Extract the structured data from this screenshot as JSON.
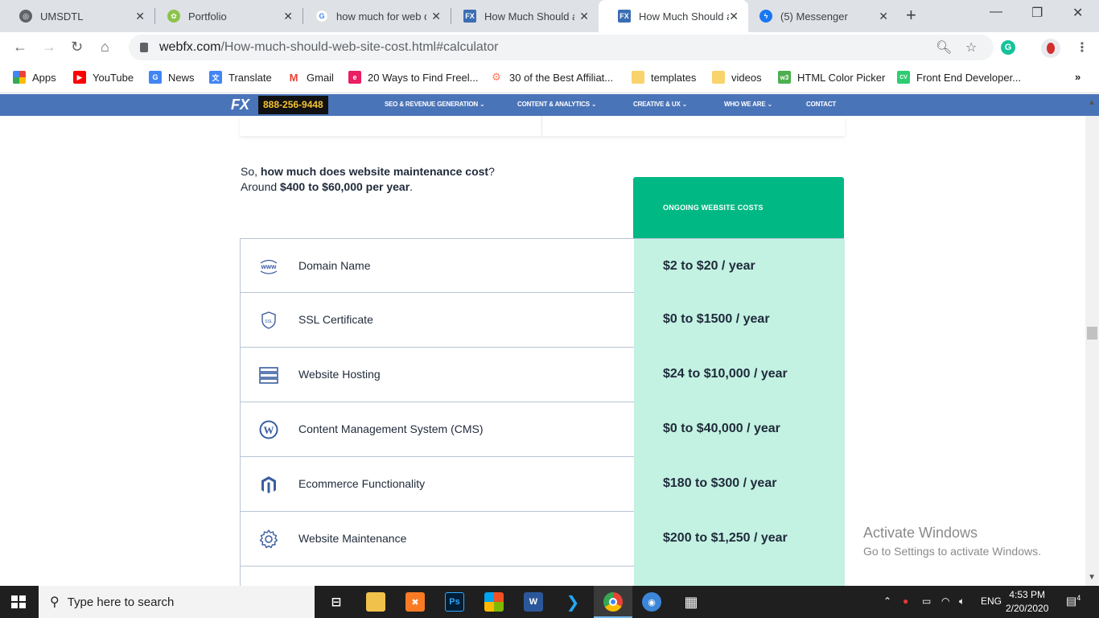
{
  "browser": {
    "tabs": [
      {
        "title": "UMSDTL",
        "icon": "globe-icon"
      },
      {
        "title": "Portfolio",
        "icon": "portfolio-icon"
      },
      {
        "title": "how much for web d",
        "icon": "google-icon"
      },
      {
        "title": "How Much Should a",
        "icon": "webfx-icon"
      },
      {
        "title": "How Much Should a",
        "icon": "webfx-icon",
        "active": true
      },
      {
        "title": "(5) Messenger",
        "icon": "messenger-icon"
      }
    ],
    "url_host": "webfx.com",
    "url_path": "/How-much-should-web-site-cost.html#calculator",
    "bookmarks": [
      {
        "label": "Apps",
        "icon": "apps-icon"
      },
      {
        "label": "YouTube",
        "icon": "youtube-icon"
      },
      {
        "label": "News",
        "icon": "news-icon"
      },
      {
        "label": "Translate",
        "icon": "translate-icon"
      },
      {
        "label": "Gmail",
        "icon": "gmail-icon"
      },
      {
        "label": "20 Ways to Find Freel...",
        "icon": "e-icon"
      },
      {
        "label": "30 of the Best Affiliat...",
        "icon": "hubspot-icon"
      },
      {
        "label": "templates",
        "icon": "folder-icon"
      },
      {
        "label": "videos",
        "icon": "folder-icon"
      },
      {
        "label": "HTML Color Picker",
        "icon": "w3-icon"
      },
      {
        "label": "Front End Developer...",
        "icon": "cv-icon"
      }
    ],
    "more_bookmarks": "»"
  },
  "site_nav": {
    "logo": "FX",
    "phone": "888-256-9448",
    "items": [
      "SEO & REVENUE GENERATION",
      "CONTENT & ANALYTICS",
      "CREATIVE & UX",
      "WHO WE ARE",
      "CONTACT"
    ],
    "brand_color": "#4a74b8"
  },
  "content": {
    "intro_line1_prefix": "So, ",
    "intro_line1_bold": "how much does website maintenance cost",
    "intro_line1_suffix": "?",
    "intro_line2_prefix": "Around ",
    "intro_line2_bold": "$400 to $60,000 per year",
    "intro_line2_suffix": ".",
    "cost_header": "ONGOING WEBSITE COSTS",
    "accent_color": "#00b883",
    "rows": [
      {
        "icon": "www-icon",
        "name": "Domain Name",
        "cost": "$2 to $20 / year"
      },
      {
        "icon": "ssl-shield-icon",
        "name": "SSL Certificate",
        "cost": "$0 to $1500 / year"
      },
      {
        "icon": "server-stack-icon",
        "name": "Website Hosting",
        "cost": "$24 to $10,000 / year"
      },
      {
        "icon": "wordpress-icon",
        "name": "Content Management System (CMS)",
        "cost": "$0 to $40,000 / year"
      },
      {
        "icon": "magento-icon",
        "name": "Ecommerce Functionality",
        "cost": "$180 to $300 / year"
      },
      {
        "icon": "gear-icon",
        "name": "Website Maintenance",
        "cost": "$200 to $1,250 / year"
      }
    ]
  },
  "watermark": {
    "line1": "Activate Windows",
    "line2": "Go to Settings to activate Windows."
  },
  "taskbar": {
    "search_placeholder": "Type here to search",
    "language": "ENG",
    "time": "4:53 PM",
    "date": "2/20/2020",
    "notifications": "4"
  }
}
